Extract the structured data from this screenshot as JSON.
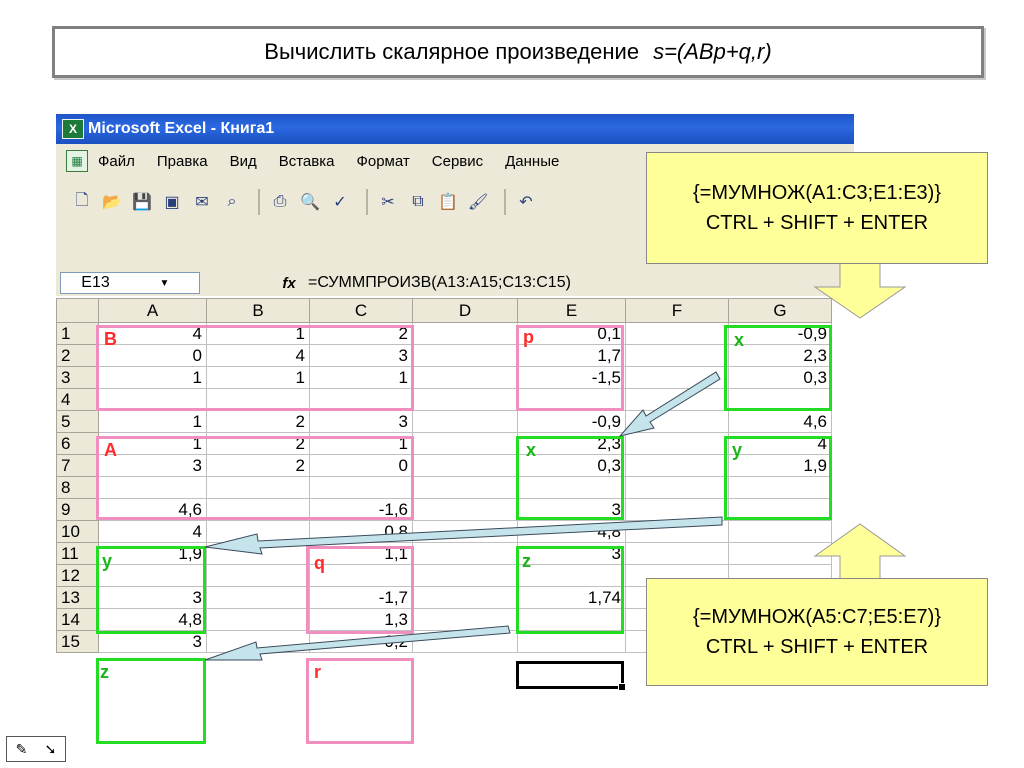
{
  "slide": {
    "title_text": "Вычислить скалярное произведение",
    "title_formula": "s=(ABp+q,r)"
  },
  "excel": {
    "window_title": "Microsoft Excel - Книга1",
    "menu": [
      "Файл",
      "Правка",
      "Вид",
      "Вставка",
      "Формат",
      "Сервис",
      "Данные"
    ],
    "name_box": "E13",
    "fx_label": "fx",
    "formula": "=СУММПРОИЗВ(A13:A15;C13:C15)",
    "columns": [
      "A",
      "B",
      "C",
      "D",
      "E",
      "F",
      "G"
    ],
    "rows": [
      {
        "n": "1",
        "cells": [
          "4",
          "1",
          "2",
          "",
          "0,1",
          "",
          "-0,9"
        ]
      },
      {
        "n": "2",
        "cells": [
          "0",
          "4",
          "3",
          "",
          "1,7",
          "",
          "2,3"
        ]
      },
      {
        "n": "3",
        "cells": [
          "1",
          "1",
          "1",
          "",
          "-1,5",
          "",
          "0,3"
        ]
      },
      {
        "n": "4",
        "cells": [
          "",
          "",
          "",
          "",
          "",
          "",
          ""
        ]
      },
      {
        "n": "5",
        "cells": [
          "1",
          "2",
          "3",
          "",
          "-0,9",
          "",
          "4,6"
        ]
      },
      {
        "n": "6",
        "cells": [
          "1",
          "2",
          "1",
          "",
          "2,3",
          "",
          "4"
        ]
      },
      {
        "n": "7",
        "cells": [
          "3",
          "2",
          "0",
          "",
          "0,3",
          "",
          "1,9"
        ]
      },
      {
        "n": "8",
        "cells": [
          "",
          "",
          "",
          "",
          "",
          "",
          ""
        ]
      },
      {
        "n": "9",
        "cells": [
          "4,6",
          "",
          "-1,6",
          "",
          "3",
          "",
          ""
        ]
      },
      {
        "n": "10",
        "cells": [
          "4",
          "",
          "0,8",
          "",
          "4,8",
          "",
          ""
        ]
      },
      {
        "n": "11",
        "cells": [
          "1,9",
          "",
          "1,1",
          "",
          "3",
          "",
          ""
        ]
      },
      {
        "n": "12",
        "cells": [
          "",
          "",
          "",
          "",
          "",
          "",
          ""
        ]
      },
      {
        "n": "13",
        "cells": [
          "3",
          "",
          "-1,7",
          "",
          "1,74",
          "",
          ""
        ]
      },
      {
        "n": "14",
        "cells": [
          "4,8",
          "",
          "1,3",
          "",
          "",
          "",
          ""
        ]
      },
      {
        "n": "15",
        "cells": [
          "3",
          "",
          "0,2",
          "",
          "",
          "",
          ""
        ]
      }
    ],
    "labels": {
      "B": "B",
      "p": "p",
      "x1": "x",
      "A": "A",
      "x2": "x",
      "y1": "y",
      "y2": "y",
      "q": "q",
      "z1": "z",
      "z2": "z",
      "r": "r"
    }
  },
  "callouts": {
    "top_line1": "{=МУМНОЖ(A1:C3;E1:E3)}",
    "top_line2": "CTRL + SHIFT + ENTER",
    "bottom_line1": "{=МУМНОЖ(A5:C7;E5:E7)}",
    "bottom_line2": "CTRL + SHIFT + ENTER"
  }
}
